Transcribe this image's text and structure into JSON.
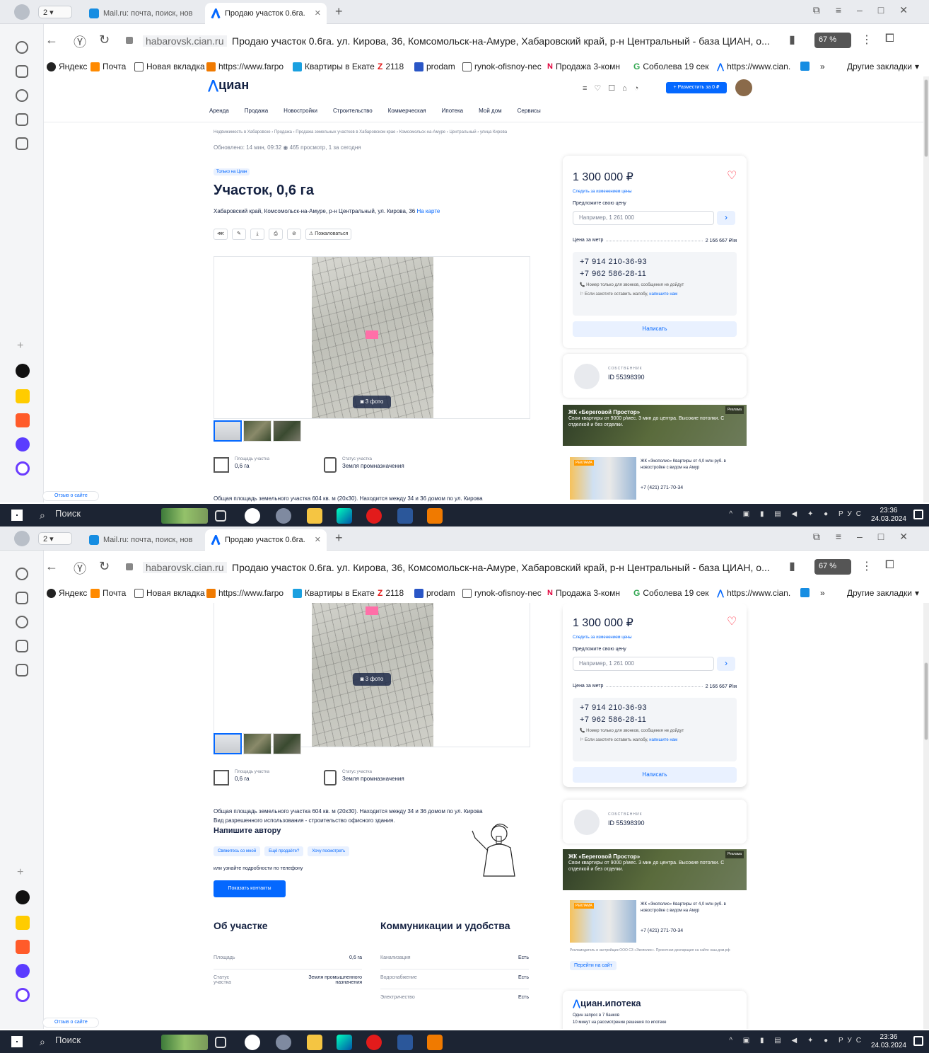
{
  "browser": {
    "tab_count": "2",
    "tabs": [
      {
        "label": "Mail.ru: почта, поиск, нов"
      },
      {
        "label": "Продаю участок 0.6га."
      }
    ],
    "url_domain": "habarovsk.cian.ru",
    "url_title": "Продаю участок 0.6га. ул. Кирова, 36, Комсомольск-на-Амуре, Хабаровский край, р-н Центральный - база ЦИАН, о...",
    "protect_badge": "67 %",
    "bookmarks": [
      "Яндекс",
      "Почта",
      "Новая вкладка",
      "https://www.farpo",
      "Квартиры в Екате",
      "2118",
      "prodam",
      "rynok-ofisnoy-nec",
      "Продажа 3-комн",
      "Соболева 19 сек",
      "https://www.cian.",
      "»",
      "Другие закладки"
    ]
  },
  "site": {
    "logo": "циан",
    "nav": [
      "Аренда",
      "Продажа",
      "Новостройки",
      "Строительство",
      "Коммерческая",
      "Ипотека",
      "Мой дом",
      "Сервисы"
    ],
    "place_button": "+ Разместить за 0 ₽",
    "breadcrumbs": "Недвижимость в Хабаровске  ›  Продажа  ›  Продажа земельных участков в Хабаровском крае  ›  Комсомольск-на-Амуре  ›  Центральный  ›  улица Кирова",
    "updated": "Обновлено: 14 мин, 09:32   ◉  465 просмотр, 1 за сегодня",
    "only_badge": "Только на Циан",
    "title": "Участок, 0,6 га",
    "address": "Хабаровский край, Комсомольск-на-Амуре, р-н Центральный, ул. Кирова, 36",
    "map_link": "На карте",
    "complain": "Пожаловаться",
    "photo_count": "3 фото",
    "facts": [
      {
        "label": "Площадь участка",
        "value": "0,6 га"
      },
      {
        "label": "Статус участка",
        "value": "Земля промназначения"
      }
    ],
    "description": "Общая площадь земельного участка 604 кв. м (20х30). Находится между 34 и 36 домом по ул. Кирова",
    "description2": "Вид разрешенного использования - строительство офисного здания.",
    "write_author": "Напишите автору",
    "chips": [
      "Свяжитесь со мной",
      "Ещё продаёте?",
      "Хочу посмотреть"
    ],
    "or_phone": "или узнайте подробности по телефону",
    "show_contacts": "Показать контакты",
    "about_title": "Об участке",
    "comm_title": "Коммуникации и удобства",
    "about_rows": [
      {
        "k": "Площадь",
        "v": "0,6 га"
      },
      {
        "k": "Статус участка",
        "v": "Земля промышленного назначения"
      }
    ],
    "comm_rows": [
      {
        "k": "Канализация",
        "v": "Есть"
      },
      {
        "k": "Водоснабжение",
        "v": "Есть"
      },
      {
        "k": "Электричество",
        "v": "Есть"
      }
    ],
    "feedback": "Отзыв о сайте"
  },
  "card": {
    "price": "1 300 000 ₽",
    "watch": "Следить за изменением цены",
    "offer_label": "Предложите свою цену",
    "offer_placeholder": "Например, 1 261 000",
    "ppm_label": "Цена за метр",
    "ppm_value": "2 166 667 ₽/м",
    "phone1": "+7 914 210-36-93",
    "phone2": "+7 962 586-28-11",
    "note1": "Номер только для звонков, сообщения не дойдут",
    "note2": "Если захотите оставить жалобу,",
    "note2_link": "напишите нам",
    "write": "Написать"
  },
  "agent": {
    "label": "СОБСТВЕННИК",
    "id": "ID 55398390"
  },
  "ads": {
    "ad1_title": "ЖК «Береговой Простор»",
    "ad1_text": "Свои квартиры от 9000 р/мес. 3 мин до центра. Высокие потолки. С отделкой и без отделки.",
    "ad1_tag": "Реклама",
    "ad2_tag": "РЕКЛАМА",
    "ad2_text": "ЖК «Экополис» Квартиры от 4,0 млн руб. в новостройке с видом на Амур",
    "ad2_phone": "+7 (421) 271-70-34",
    "ad2_small": "Рекламодатель и застройщик ООО СЗ «Экополис». Проектная декларация на сайте наш.дом.рф",
    "ad2_go": "Перейти на сайт",
    "ipoteka_logo": "циан.ипотека",
    "ipoteka_s1": "Один запрос в 7 банков",
    "ipoteka_s2": "10 минут на рассмотрение решения по ипотеке"
  },
  "taskbar": {
    "search": "Поиск",
    "lang": "РУС",
    "time": "23:36",
    "date": "24.03.2024"
  }
}
